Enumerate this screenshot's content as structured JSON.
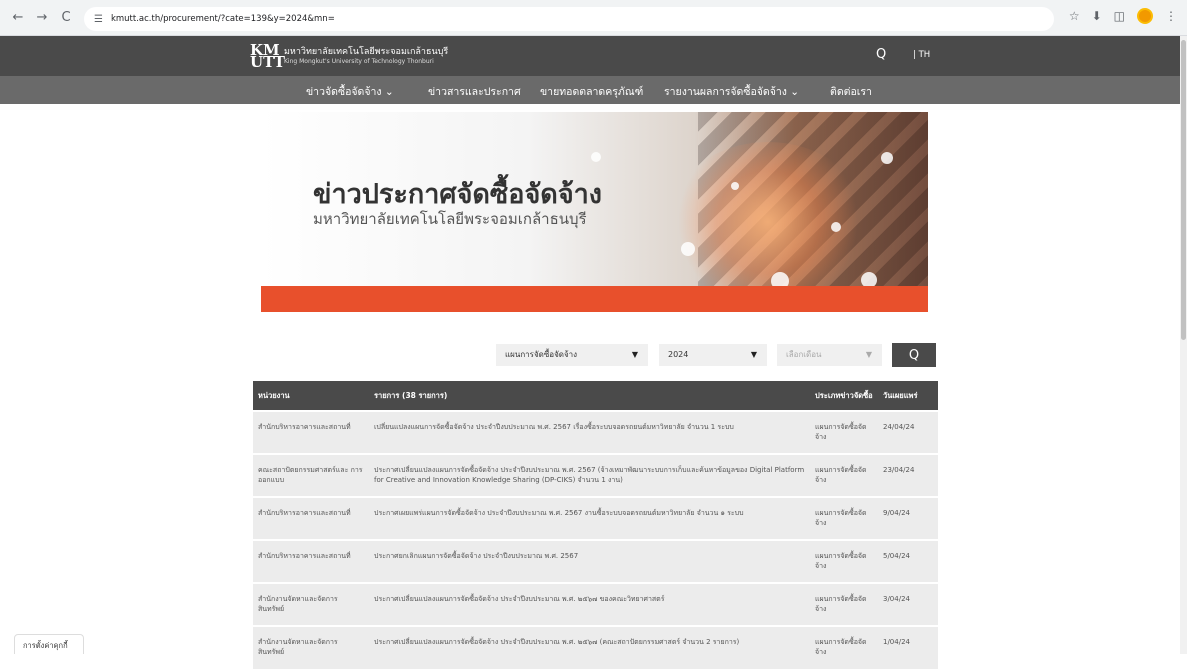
{
  "browser": {
    "url": "kmutt.ac.th/procurement/?cate=139&y=2024&mn=",
    "back_glyph": "←",
    "forward_glyph": "→",
    "reload_glyph": "C",
    "site_icon_glyph": "☰",
    "star_glyph": "☆",
    "download_glyph": "⬇",
    "extensions_glyph": "◫",
    "menu_glyph": "⋮"
  },
  "header": {
    "logo_mark": "KM UTT",
    "logo_th": "มหาวิทยาลัยเทคโนโลยีพระจอมเกล้าธนบุรี",
    "logo_en": "King Mongkut's University of Technology Thonburi",
    "search_glyph": "Q",
    "lang_label": "| TH"
  },
  "nav": {
    "items": [
      "ข่าวจัดซื้อจัดจ้าง ⌄",
      "ข่าวสารและประกาศ",
      "ขายทอดตลาดครุภัณฑ์",
      "รายงานผลการจัดซื้อจัดจ้าง ⌄",
      "ติดต่อเรา"
    ]
  },
  "banner": {
    "title": "ข่าวประกาศจัดซื้อจัดจ้าง",
    "subtitle": "มหาวิทยาลัยเทคโนโลยีพระจอมเกล้าธนบุรี"
  },
  "filters": {
    "category": "แผนการจัดซื้อจัดจ้าง",
    "year": "2024",
    "month_placeholder": "เลือกเดือน",
    "caret": "▼",
    "search_glyph": "Q"
  },
  "table": {
    "headers": [
      "หน่วยงาน",
      "รายการ (38 รายการ)",
      "ประเภทข่าวจัดซื้อ",
      "วันเผยแพร่"
    ],
    "rows": [
      {
        "dept": "สำนักบริหารอาคารและสถานที่",
        "item": "เปลี่ยนแปลงแผนการจัดซื้อจัดจ้าง ประจำปีงบประมาณ พ.ศ. 2567 เรื่องซื้อระบบจอดรถยนต์มหาวิทยาลัย จำนวน 1 ระบบ",
        "type": "แผนการจัดซื้อจัด จ้าง",
        "date": "24/04/24"
      },
      {
        "dept": "คณะสถาปัตยกรรมศาสตร์และ การออกแบบ",
        "item": "ประกาศเปลี่ยนแปลงแผนการจัดซื้อจัดจ้าง ประจำปีงบประมาณ พ.ศ. 2567 (จ้างเหมาพัฒนาระบบการเก็บและค้นหาข้อมูลของ Digital Platform for Creative and Innovation Knowledge Sharing (DP-CIKS) จำนวน 1 งาน)",
        "type": "แผนการจัดซื้อจัด จ้าง",
        "date": "23/04/24"
      },
      {
        "dept": "สำนักบริหารอาคารและสถานที่",
        "item": "ประกาศเผยแพร่แผนการจัดซื้อจัดจ้าง ประจำปีงบประมาณ พ.ศ. 2567 งานซื้อระบบจอดรถยนต์มหาวิทยาลัย จำนวน ๑ ระบบ",
        "type": "แผนการจัดซื้อจัด จ้าง",
        "date": "9/04/24"
      },
      {
        "dept": "สำนักบริหารอาคารและสถานที่",
        "item": "ประกาศยกเลิกแผนการจัดซื้อจัดจ้าง ประจำปีงบประมาณ พ.ศ. 2567",
        "type": "แผนการจัดซื้อจัด จ้าง",
        "date": "5/04/24"
      },
      {
        "dept": "สำนักงานจัดหาและจัดการ สินทรัพย์",
        "item": "ประกาศเปลี่ยนแปลงแผนการจัดซื้อจัดจ้าง ประจำปีงบประมาณ พ.ศ. ๒๕๖๗ ของคณะวิทยาศาสตร์",
        "type": "แผนการจัดซื้อจัด จ้าง",
        "date": "3/04/24"
      },
      {
        "dept": "สำนักงานจัดหาและจัดการ สินทรัพย์",
        "item": "ประกาศเปลี่ยนแปลงแผนการจัดซื้อจัดจ้าง ประจำปีงบประมาณ พ.ศ. ๒๕๖๗ (คณะสถาปัตยกรรมศาสตร์ จำนวน 2 รายการ)",
        "type": "แผนการจัดซื้อจัด จ้าง",
        "date": "1/04/24"
      }
    ]
  },
  "cookie_label": "การตั้งค่าคุกกี้"
}
